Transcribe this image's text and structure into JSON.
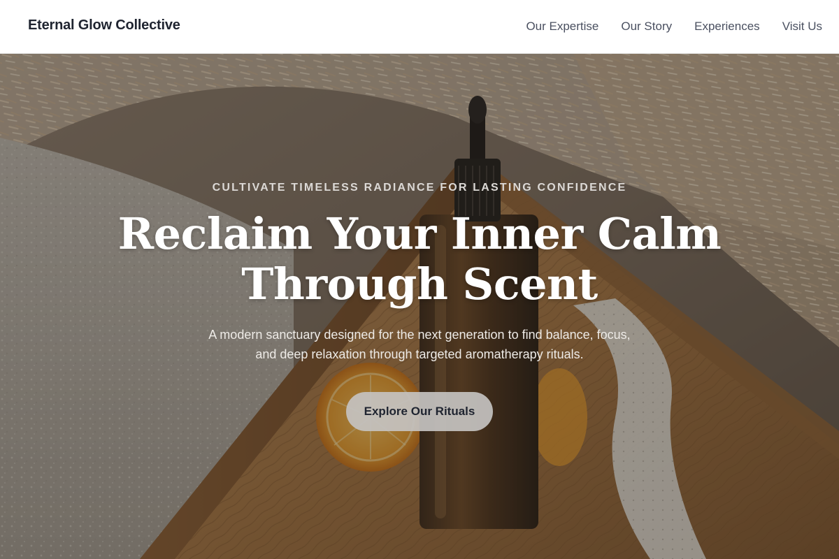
{
  "header": {
    "brand": "Eternal Glow Collective",
    "nav": [
      {
        "label": "Our Expertise"
      },
      {
        "label": "Our Story"
      },
      {
        "label": "Experiences"
      },
      {
        "label": "Visit Us"
      }
    ]
  },
  "hero": {
    "eyebrow": "CULTIVATE TIMELESS RADIANCE FOR LASTING CONFIDENCE",
    "headline_line1": "Reclaim Your Inner Calm",
    "headline_line2": "Through Scent",
    "subhead_line1": "A modern sanctuary designed for the next generation to find balance, focus,",
    "subhead_line2": "and deep relaxation through targeted aromatherapy rituals.",
    "cta_label": "Explore Our Rituals",
    "background_image": "amber dropper bottle with orange slice and dried grasses on wooden tray"
  },
  "colors": {
    "brand_text": "#1f2430",
    "nav_text": "#4a5060",
    "cta_bg": "#c4c2c0"
  }
}
